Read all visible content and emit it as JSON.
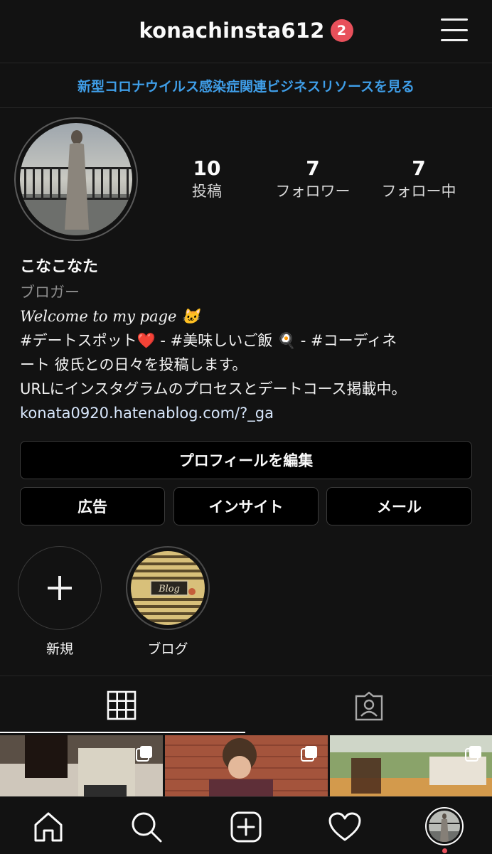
{
  "header": {
    "username": "konachinsta612",
    "notification_count": "2"
  },
  "banner": {
    "text": "新型コロナウイルス感染症関連ビジネスリソースを見る"
  },
  "stats": [
    {
      "value": "10",
      "label": "投稿"
    },
    {
      "value": "7",
      "label": "フォロワー"
    },
    {
      "value": "7",
      "label": "フォロー中"
    }
  ],
  "bio": {
    "display_name": "こなこなた",
    "category": "ブロガー",
    "welcome": "Welcome to my page 🐱",
    "line1": "#デートスポット❤️ - #美味しいご飯 🍳 - #コーディネ",
    "line2": "ート 彼氏との日々を投稿します。",
    "line3": "URLにインスタグラムのプロセスとデートコース掲載中。",
    "link": "konata0920.hatenablog.com/?_ga"
  },
  "buttons": {
    "edit_profile": "プロフィールを編集",
    "ads": "広告",
    "insights": "インサイト",
    "email": "メール"
  },
  "highlights": [
    {
      "label": "新規",
      "icon": "plus-icon"
    },
    {
      "label": "ブログ",
      "cover_text": "Blog"
    }
  ],
  "tabs": [
    {
      "icon": "grid-icon"
    },
    {
      "icon": "tagged-icon"
    }
  ],
  "nav": [
    {
      "icon": "home-icon"
    },
    {
      "icon": "search-icon"
    },
    {
      "icon": "new-post-icon"
    },
    {
      "icon": "heart-icon"
    },
    {
      "icon": "profile-avatar-icon"
    }
  ],
  "colors": {
    "background": "#121212",
    "link_blue": "#3f9ee8",
    "badge_red": "#e8505b"
  }
}
